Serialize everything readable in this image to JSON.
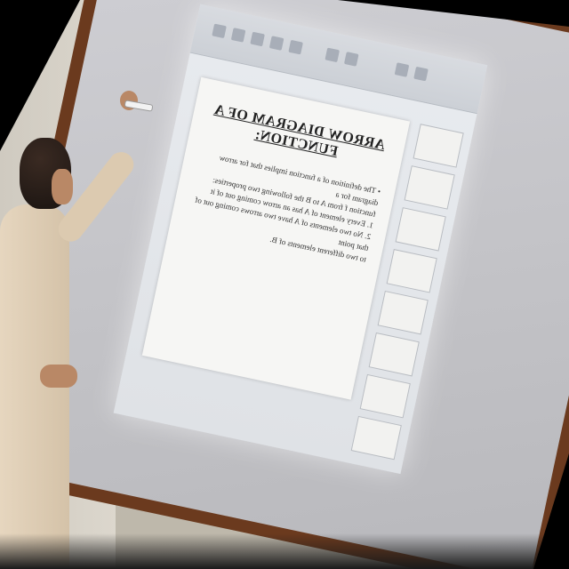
{
  "scene": {
    "slide": {
      "title": "ARROW DIAGRAM OF A FUNCTION:",
      "lines": [
        "• The definition of a function implies that for arrow diagram for a",
        "function f from A to B the following two properties:",
        "1.  Every element of A has an arrow coming out of it",
        "2.  No two elements of A have two arrows coming out of that point",
        "    to two different elements of B."
      ]
    },
    "thumbnail_count": 8
  }
}
